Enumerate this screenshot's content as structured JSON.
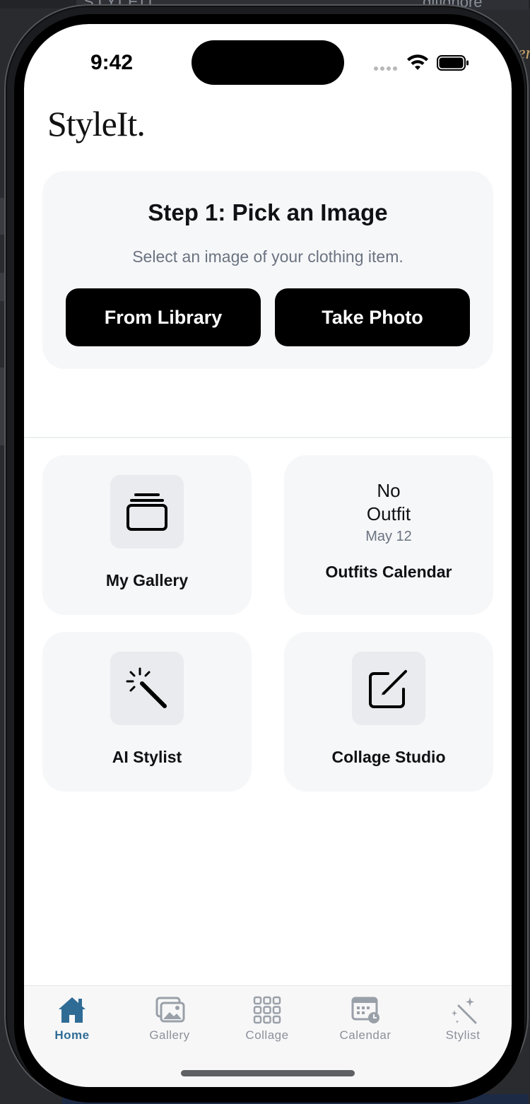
{
  "status_bar": {
    "time": "9:42"
  },
  "background": {
    "left_text": "STYLEIT",
    "right_text": ".gitignore"
  },
  "app": {
    "logo": "StyleIt."
  },
  "step_card": {
    "title": "Step 1: Pick an Image",
    "subtitle": "Select an image of your clothing item.",
    "library_button": "From Library",
    "photo_button": "Take Photo"
  },
  "tiles": [
    {
      "label": "My Gallery",
      "icon": "gallery-stack-icon"
    },
    {
      "label": "Outfits Calendar",
      "status_line1": "No",
      "status_line2": "Outfit",
      "date": "May 12"
    },
    {
      "label": "AI Stylist",
      "icon": "magic-wand-icon"
    },
    {
      "label": "Collage Studio",
      "icon": "edit-square-icon"
    }
  ],
  "tabbar": {
    "active_color": "#2f6c95",
    "items": [
      {
        "label": "Home",
        "icon": "house-icon",
        "active": true
      },
      {
        "label": "Gallery",
        "icon": "photos-icon",
        "active": false
      },
      {
        "label": "Collage",
        "icon": "grid-icon",
        "active": false
      },
      {
        "label": "Calendar",
        "icon": "calendar-icon",
        "active": false
      },
      {
        "label": "Stylist",
        "icon": "sparkle-wand-icon",
        "active": false
      }
    ]
  }
}
